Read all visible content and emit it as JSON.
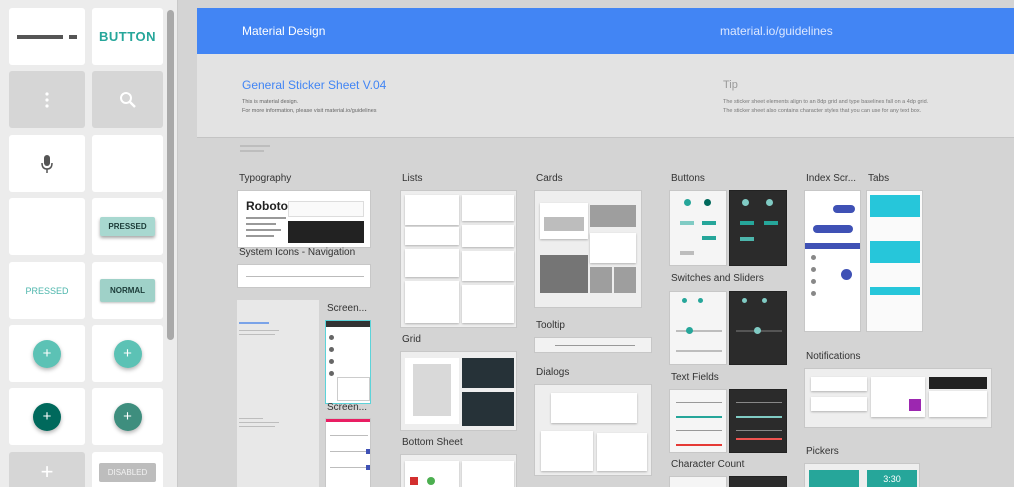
{
  "panel": {
    "button_label": "BUTTON",
    "pressed_chip": "PRESSED",
    "pressed_text": "PRESSED",
    "normal_chip": "NORMAL",
    "disabled_chip": "DISABLED",
    "fab_glyph": "+"
  },
  "header": {
    "title": "Material Design",
    "url": "material.io/guidelines"
  },
  "intro": {
    "title": "General Sticker Sheet V.04",
    "description": "This is material design.\nFor more information, please visit material.io/guidelines",
    "tip_title": "Tip",
    "tip_text": "The sticker sheet elements align to an 8dp grid and type baselines fall on a 4dp grid.\nThe sticker sheet also contains character styles that you can use for any text box."
  },
  "artboards": {
    "typography": "Typography",
    "typography_sample": "Roboto",
    "system_icons": "System Icons - Navigation",
    "lists": "Lists",
    "grid": "Grid",
    "bottom_sheet": "Bottom Sheet",
    "screen1": "Screen...",
    "screen2": "Screen...",
    "cards": "Cards",
    "tooltip": "Tooltip",
    "dialogs": "Dialogs",
    "buttons": "Buttons",
    "switches": "Switches and Sliders",
    "text_fields": "Text Fields",
    "character_count": "Character Count",
    "index_scroll": "Index Scr...",
    "tabs": "Tabs",
    "notifications": "Notifications",
    "pickers": "Pickers",
    "picker_time": "3:30"
  },
  "colors": {
    "header_blue": "#4285f4",
    "teal": "#26a69a",
    "dark_teal": "#00695c"
  }
}
